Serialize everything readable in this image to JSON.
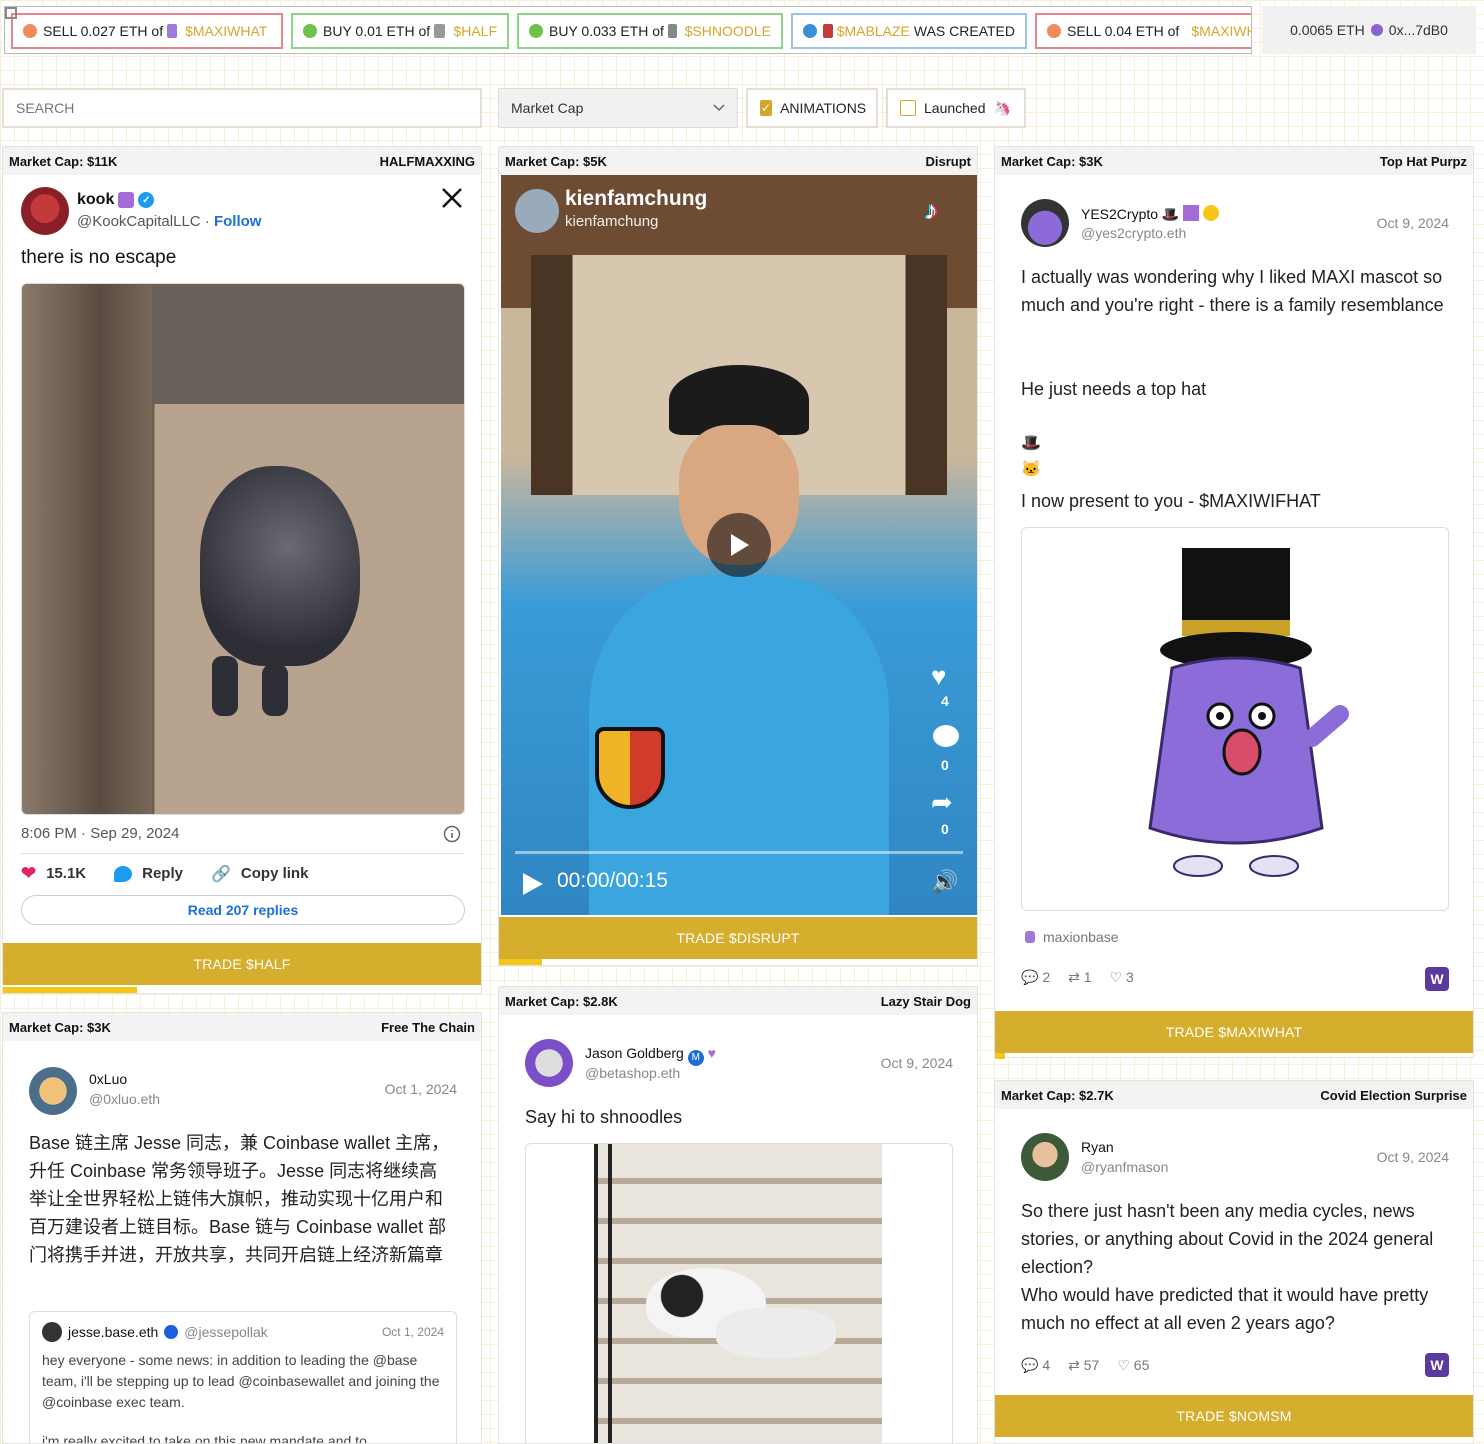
{
  "ticker": [
    {
      "action": "SELL 0.027 ETH of",
      "token": "$MAXIWHAT",
      "border": "#e5878a",
      "dot": "#f08a5d"
    },
    {
      "action": "BUY 0.01 ETH of",
      "token": "$HALF",
      "border": "#8fd48a",
      "dot": "#6cc24a"
    },
    {
      "action": "BUY 0.033 ETH of",
      "token": "$SHNOODLE",
      "border": "#8fd48a",
      "dot": "#6cc24a"
    },
    {
      "action": "WAS CREATED",
      "token": "$MABLAZE",
      "border": "#9ec3e8",
      "dot": "#3a8fd6"
    },
    {
      "action": "SELL 0.04 ETH of",
      "token": "$MAXIWHAT",
      "border": "#e5878a",
      "dot": "#f08a5d"
    }
  ],
  "wallet": {
    "balance": "0.0065 ETH",
    "address": "0x...7dB0"
  },
  "controls": {
    "search_placeholder": "SEARCH",
    "sort_value": "Market Cap",
    "animations_label": "ANIMATIONS",
    "launched_label": "Launched",
    "launched_emoji": "🦄"
  },
  "cards": {
    "half": {
      "market_cap": "Market Cap: $11K",
      "name": "HALFMAXXING",
      "user": "kook",
      "handle": "@KookCapitalLLC",
      "follow": "Follow",
      "text": "there is no escape",
      "time": "8:06 PM · Sep 29, 2024",
      "likes": "15.1K",
      "reply": "Reply",
      "copy": "Copy link",
      "read_replies": "Read 207 replies",
      "trade": "TRADE $HALF",
      "progress": 0.28
    },
    "disrupt": {
      "market_cap": "Market Cap: $5K",
      "name": "Disrupt",
      "user": "kienfamchung",
      "handle": "kienfamchung",
      "likes": "4",
      "comments": "0",
      "shares": "0",
      "time": "00:00/00:15",
      "trade": "TRADE $DISRUPT",
      "progress": 0.09
    },
    "maxiwhat": {
      "market_cap": "Market Cap: $3K",
      "name": "Top Hat Purpz",
      "user": "YES2Crypto 🎩",
      "handle": "@yes2crypto.eth",
      "date": "Oct 9, 2024",
      "text1": "I actually was wondering why I liked MAXI mascot so much and you're right - there is a family resemblance",
      "text2": "He just needs a top hat",
      "emoji1": "🎩",
      "emoji2": "🐱",
      "text3": "I now present to you - $MAXIWIFHAT",
      "channel": "maxionbase",
      "replies": "2",
      "recasts": "1",
      "likes": "3",
      "trade": "TRADE $MAXIWHAT",
      "progress": 0.02
    },
    "chain": {
      "market_cap": "Market Cap: $3K",
      "name": "Free The Chain",
      "user": "0xLuo",
      "handle": "@0xluo.eth",
      "date": "Oct 1, 2024",
      "text": "Base 链主席 Jesse 同志，兼 Coinbase wallet 主席，升任 Coinbase 常务领导班子。Jesse 同志将继续高举让全世界轻松上链伟大旗帜，推动实现十亿用户和百万建设者上链目标。Base 链与 Coinbase wallet 部门将携手并进，开放共享，共同开启链上经济新篇章",
      "quote_user": "jesse.base.eth",
      "quote_handle": "@jessepollak",
      "quote_date": "Oct 1, 2024",
      "quote_text": "hey everyone - some news: in addition to leading the @base team, i'll be stepping up to lead @coinbasewallet and joining the @coinbase exec team.",
      "quote_text2": "i'm really excited to take on this new mandate and to"
    },
    "dog": {
      "market_cap": "Market Cap: $2.8K",
      "name": "Lazy Stair Dog",
      "user": "Jason Goldberg",
      "handle": "@betashop.eth",
      "date": "Oct 9, 2024",
      "text": "Say hi to shnoodles"
    },
    "covid": {
      "market_cap": "Market Cap: $2.7K",
      "name": "Covid Election Surprise",
      "user": "Ryan",
      "handle": "@ryanfmason",
      "date": "Oct 9, 2024",
      "text": "So there just hasn't been any media cycles, news stories, or anything about Covid in the 2024 general election?",
      "text2": "Who would have predicted that it would have pretty much no effect at all even 2 years ago?",
      "replies": "4",
      "recasts": "57",
      "likes": "65",
      "trade": "TRADE $NOMSM"
    }
  },
  "colors": {
    "accent": "#d4ae2c",
    "progress": "#f5c518",
    "farcaster": "#5b3a9e",
    "like": "#e0245e",
    "link": "#1d6fd8"
  }
}
